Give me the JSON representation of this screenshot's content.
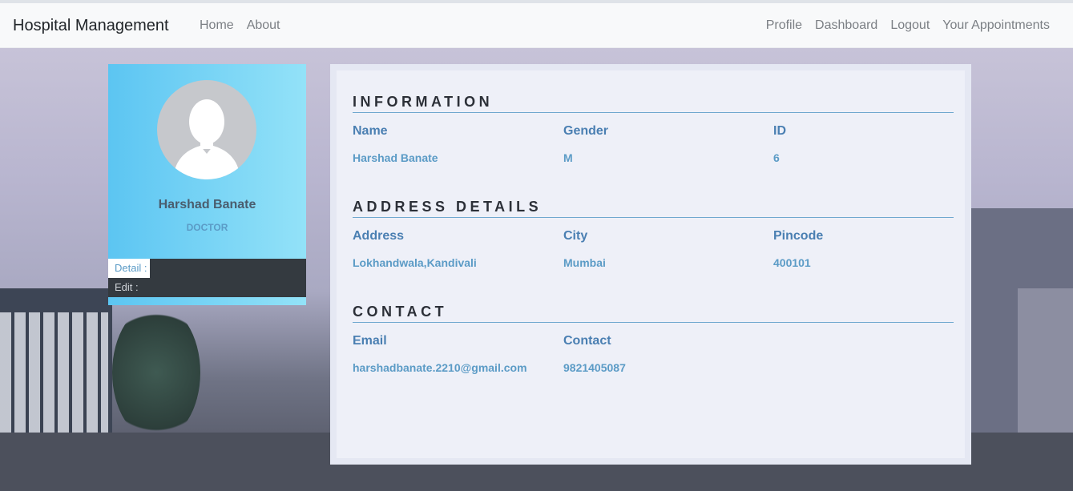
{
  "navbar": {
    "brand": "Hospital Management",
    "left_links": [
      "Home",
      "About"
    ],
    "right_links": [
      "Profile",
      "Dashboard",
      "Logout",
      "Your Appointments"
    ]
  },
  "profile": {
    "name": "Harshad Banate",
    "role": "DOCTOR",
    "menu": [
      "Detail :",
      "Edit :"
    ]
  },
  "info": {
    "information_title": "INFORMATION",
    "information": [
      {
        "label": "Name",
        "value": "Harshad Banate"
      },
      {
        "label": "Gender",
        "value": "M"
      },
      {
        "label": "ID",
        "value": "6"
      }
    ],
    "address_title": "ADDRESS DETAILS",
    "address": [
      {
        "label": "Address",
        "value": "Lokhandwala,Kandivali"
      },
      {
        "label": "City",
        "value": "Mumbai"
      },
      {
        "label": "Pincode",
        "value": "400101"
      }
    ],
    "contact_title": "CONTACT",
    "contact": [
      {
        "label": "Email",
        "value": "harshadbanate.2210@gmail.com"
      },
      {
        "label": "Contact",
        "value": "9821405087"
      }
    ]
  },
  "colors": {
    "navbar_bg": "#f8f9fa",
    "card_gradient_start": "#5cc5f2",
    "card_gradient_end": "#93e2f8",
    "menu_bg": "#343a40",
    "accent_text": "#4a7fb2"
  }
}
